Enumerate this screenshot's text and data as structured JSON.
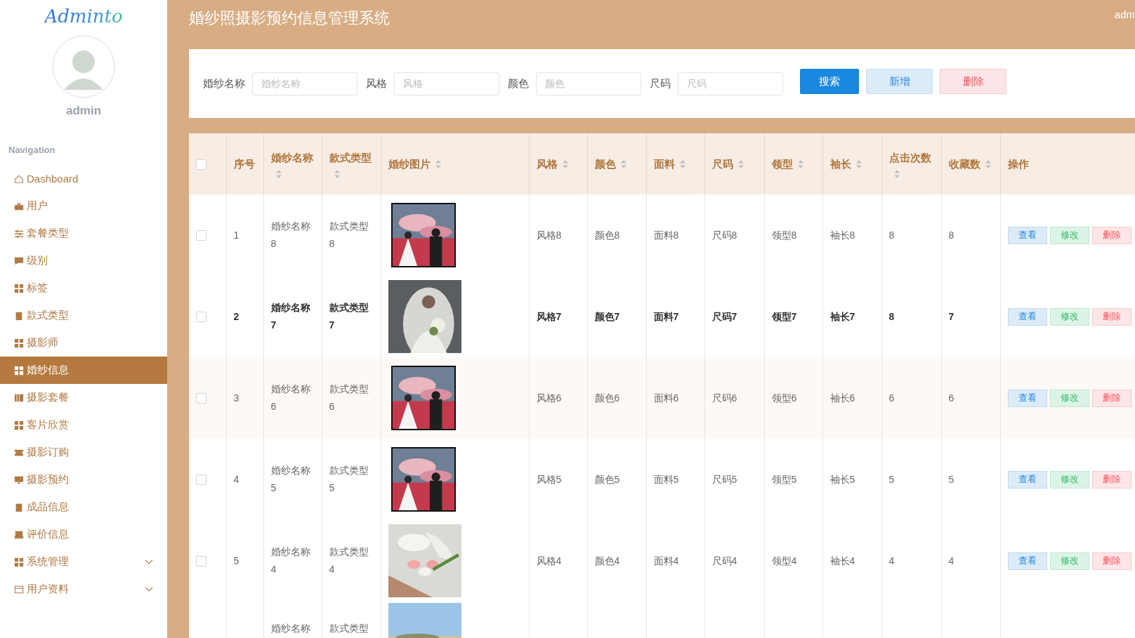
{
  "logo": "Adminto",
  "user": {
    "name": "admin"
  },
  "nav_heading": "Navigation",
  "sidebar": {
    "items": [
      {
        "label": "Dashboard",
        "selected": false
      },
      {
        "label": "用户",
        "selected": false
      },
      {
        "label": "套餐类型",
        "selected": false
      },
      {
        "label": "级别",
        "selected": false
      },
      {
        "label": "标签",
        "selected": false
      },
      {
        "label": "款式类型",
        "selected": false
      },
      {
        "label": "摄影师",
        "selected": false
      },
      {
        "label": "婚纱信息",
        "selected": true
      },
      {
        "label": "摄影套餐",
        "selected": false
      },
      {
        "label": "客片欣赏",
        "selected": false
      },
      {
        "label": "摄影订购",
        "selected": false
      },
      {
        "label": "摄影预约",
        "selected": false
      },
      {
        "label": "成品信息",
        "selected": false
      },
      {
        "label": "评价信息",
        "selected": false
      },
      {
        "label": "系统管理",
        "selected": false,
        "expanded": false
      },
      {
        "label": "用户资料",
        "selected": false,
        "expanded": false
      }
    ]
  },
  "header": {
    "title": "婚纱照摄影预约信息管理系统",
    "user": "adm"
  },
  "search": {
    "fields": [
      {
        "label": "婚纱名称",
        "placeholder": "婚纱名称"
      },
      {
        "label": "风格",
        "placeholder": "风格"
      },
      {
        "label": "颜色",
        "placeholder": "颜色"
      },
      {
        "label": "尺码",
        "placeholder": "尺码"
      }
    ],
    "buttons": [
      {
        "label": "搜索",
        "kind": "primary"
      },
      {
        "label": "新增",
        "kind": "add"
      },
      {
        "label": "删除",
        "kind": "delete"
      }
    ]
  },
  "table": {
    "select_all": {
      "checked": false
    },
    "columns": [
      {
        "label": "序号",
        "sortable": false
      },
      {
        "label": "婚纱名称",
        "sortable": true
      },
      {
        "label": "款式类型",
        "sortable": true
      },
      {
        "label": "婚纱图片",
        "sortable": true
      },
      {
        "label": "风格",
        "sortable": true
      },
      {
        "label": "颜色",
        "sortable": true
      },
      {
        "label": "面料",
        "sortable": true
      },
      {
        "label": "尺码",
        "sortable": true
      },
      {
        "label": "领型",
        "sortable": true
      },
      {
        "label": "袖长",
        "sortable": true
      },
      {
        "label": "点击次数",
        "sortable": true
      },
      {
        "label": "收藏数",
        "sortable": true
      },
      {
        "label": "操作",
        "sortable": false
      }
    ],
    "rows": [
      {
        "checked": false,
        "emphasized": false,
        "index": "1",
        "name": "婚纱名称8",
        "style_type": "款式类型8",
        "picture": {
          "kind": "picture"
        },
        "style": "风格8",
        "dress_color": "颜色8",
        "fabric": "面料8",
        "size": "尺码8",
        "neckline": "领型8",
        "sleeve": "袖长8",
        "clicks": "8",
        "favorites": "8",
        "actions": [
          "查看",
          "修改",
          "删除"
        ]
      },
      {
        "checked": false,
        "emphasized": true,
        "index": "2",
        "name": "婚纱名称7",
        "style_type": "款式类型7",
        "picture": {
          "kind": "picture"
        },
        "style": "风格7",
        "dress_color": "颜色7",
        "fabric": "面料7",
        "size": "尺码7",
        "neckline": "领型7",
        "sleeve": "袖长7",
        "clicks": "8",
        "favorites": "7",
        "actions": [
          "查看",
          "修改",
          "删除"
        ]
      },
      {
        "checked": false,
        "emphasized": false,
        "index": "3",
        "name": "婚纱名称6",
        "style_type": "款式类型6",
        "picture": {
          "kind": "picture"
        },
        "style": "风格6",
        "dress_color": "颜色6",
        "fabric": "面料6",
        "size": "尺码6",
        "neckline": "领型6",
        "sleeve": "袖长6",
        "clicks": "6",
        "favorites": "6",
        "actions": [
          "查看",
          "修改",
          "删除"
        ]
      },
      {
        "checked": false,
        "emphasized": false,
        "index": "4",
        "name": "婚纱名称5",
        "style_type": "款式类型5",
        "picture": {
          "kind": "picture"
        },
        "style": "风格5",
        "dress_color": "颜色5",
        "fabric": "面料5",
        "size": "尺码5",
        "neckline": "领型5",
        "sleeve": "袖长5",
        "clicks": "5",
        "favorites": "5",
        "actions": [
          "查看",
          "修改",
          "删除"
        ]
      },
      {
        "checked": false,
        "emphasized": false,
        "index": "5",
        "name": "婚纱名称4",
        "style_type": "款式类型4",
        "picture": {
          "kind": "picture"
        },
        "style": "风格4",
        "dress_color": "颜色4",
        "fabric": "面料4",
        "size": "尺码4",
        "neckline": "领型4",
        "sleeve": "袖长4",
        "clicks": "4",
        "favorites": "4",
        "actions": [
          "查看",
          "修改",
          "删除"
        ]
      },
      {
        "name": "婚纱名称",
        "style_type": "款式类型",
        "picture": {
          "kind": "picture"
        }
      }
    ]
  }
}
